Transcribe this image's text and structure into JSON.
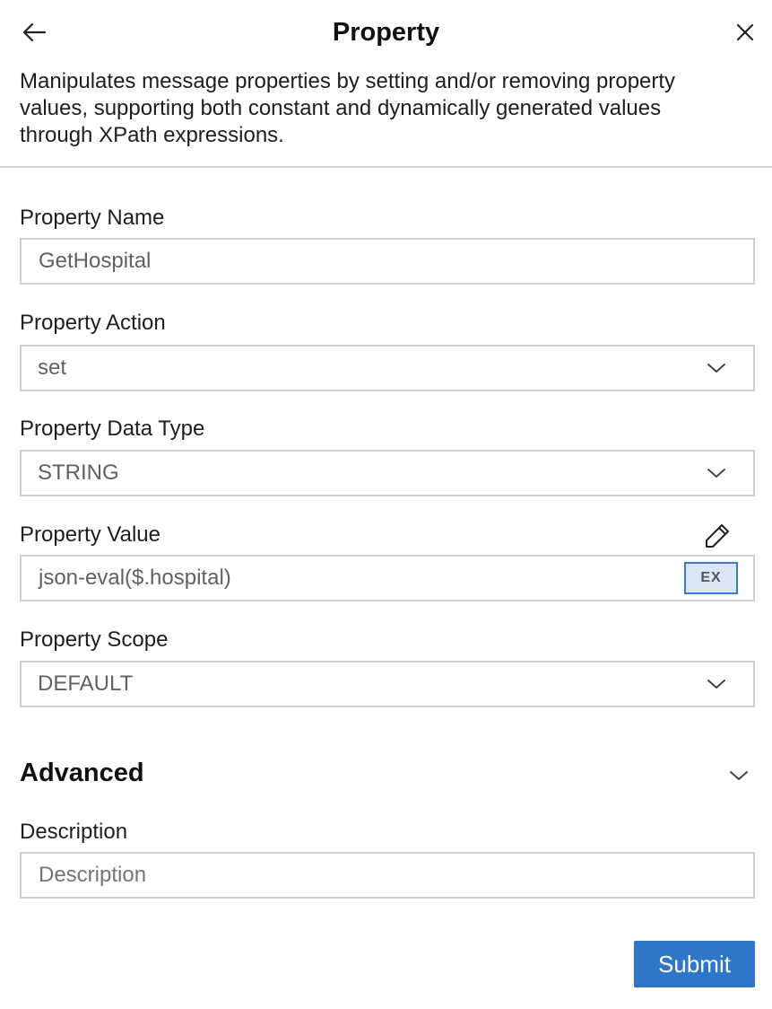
{
  "header": {
    "title": "Property",
    "back_icon": "arrow-left-icon",
    "close_icon": "close-icon"
  },
  "description": "Manipulates message properties by setting and/or removing property values, supporting both constant and dynamically generated values through XPath expressions.",
  "form": {
    "property_name": {
      "label": "Property Name",
      "value": "GetHospital"
    },
    "property_action": {
      "label": "Property Action",
      "value": "set"
    },
    "property_data_type": {
      "label": "Property Data Type",
      "value": "STRING"
    },
    "property_value": {
      "label": "Property Value",
      "value": "json-eval($.hospital)",
      "expression_badge": "EX"
    },
    "property_scope": {
      "label": "Property Scope",
      "value": "DEFAULT"
    }
  },
  "advanced": {
    "title": "Advanced",
    "description": {
      "label": "Description",
      "placeholder": "Description"
    }
  },
  "actions": {
    "submit_label": "Submit"
  },
  "colors": {
    "accent": "#2f76c9",
    "badge_bg": "#dbe7f5",
    "field_border": "#d0d0d0"
  }
}
